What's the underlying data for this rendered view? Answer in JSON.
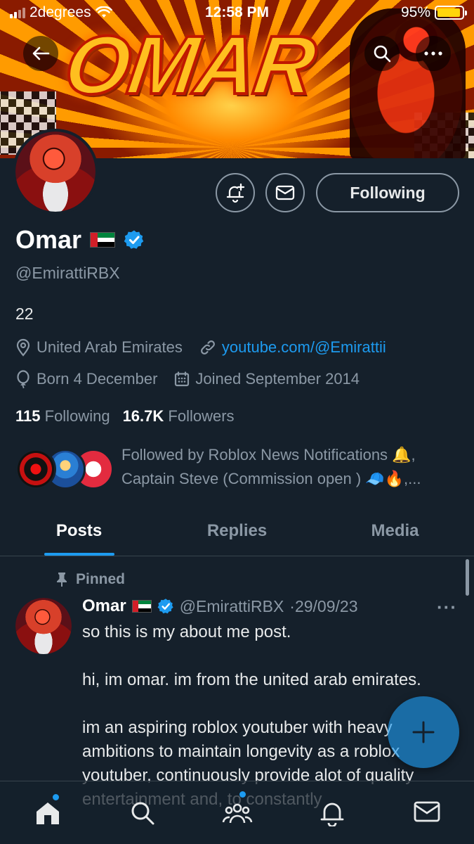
{
  "status_bar": {
    "carrier": "2degrees",
    "time": "12:58 PM",
    "battery": "95%",
    "battery_level": 0.95
  },
  "banner": {
    "title": "OMAR"
  },
  "profile": {
    "name": "Omar",
    "flag": "uae-flag",
    "verified": true,
    "handle": "@EmirattiRBX",
    "bio": "22",
    "location": "United Arab Emirates",
    "website": "youtube.com/@Emirattii",
    "birthday": "Born 4 December",
    "joined": "Joined September 2014",
    "following_count": "115",
    "following_label": "Following",
    "followers_count": "16.7K",
    "followers_label": "Followers",
    "follow_button": "Following",
    "followed_by_line1": "Followed by Roblox News Notifications 🔔,",
    "followed_by_line2": "Captain Steve (Commission open ) 🧢🔥,..."
  },
  "tabs": [
    "Posts",
    "Replies",
    "Media"
  ],
  "post": {
    "pinned_label": "Pinned",
    "name": "Omar",
    "handle": "@EmirattiRBX",
    "date": "·29/09/23",
    "more": "···",
    "paragraphs": [
      "so this is my about me post.",
      "hi, im omar. im from the united arab emirates.",
      "im an aspiring roblox youtuber with heavy ambitions to maintain longevity as a roblox youtuber, continuously provide alot of quality entertainment and, to constantly"
    ]
  },
  "colors": {
    "background": "#15202b",
    "accent": "#1d9bf0",
    "secondary_text": "#8b98a5"
  },
  "icons": {
    "back": "back-arrow-icon",
    "search": "search-icon",
    "more": "more-icon",
    "notify": "bell-plus-icon",
    "message": "envelope-icon",
    "location": "location-pin-icon",
    "link": "link-icon",
    "birthday": "balloon-icon",
    "calendar": "calendar-icon",
    "pin": "pin-icon",
    "compose": "plus-icon",
    "nav": [
      "home-icon",
      "search-icon",
      "communities-icon",
      "bell-icon",
      "envelope-icon"
    ]
  }
}
